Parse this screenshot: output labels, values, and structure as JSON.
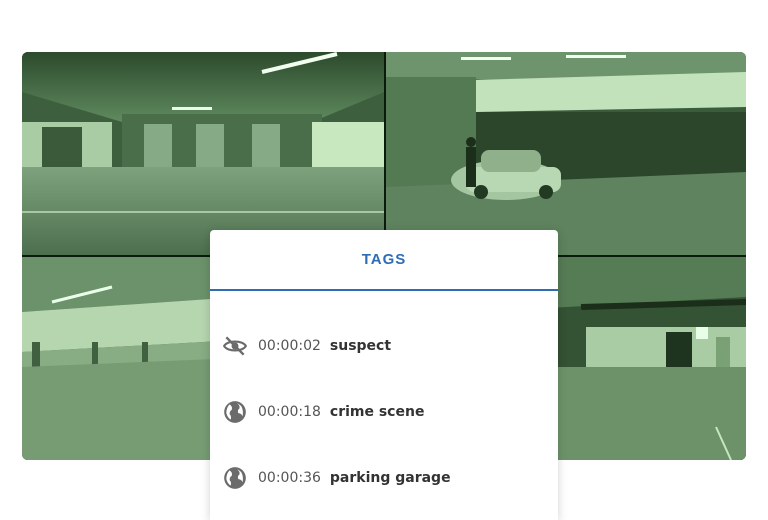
{
  "panel": {
    "title": "TAGS",
    "accent_color": "#2e6db4"
  },
  "tags": [
    {
      "icon": "eye-off-icon",
      "time": "00:00:02",
      "label": "suspect"
    },
    {
      "icon": "globe-icon",
      "time": "00:00:18",
      "label": "crime scene"
    },
    {
      "icon": "globe-icon",
      "time": "00:00:36",
      "label": "parking garage"
    }
  ],
  "feeds": [
    {
      "scene": "parking garage elevators"
    },
    {
      "scene": "parking garage with car and person"
    },
    {
      "scene": "parking garage ramp"
    },
    {
      "scene": "parking garage exit"
    }
  ]
}
